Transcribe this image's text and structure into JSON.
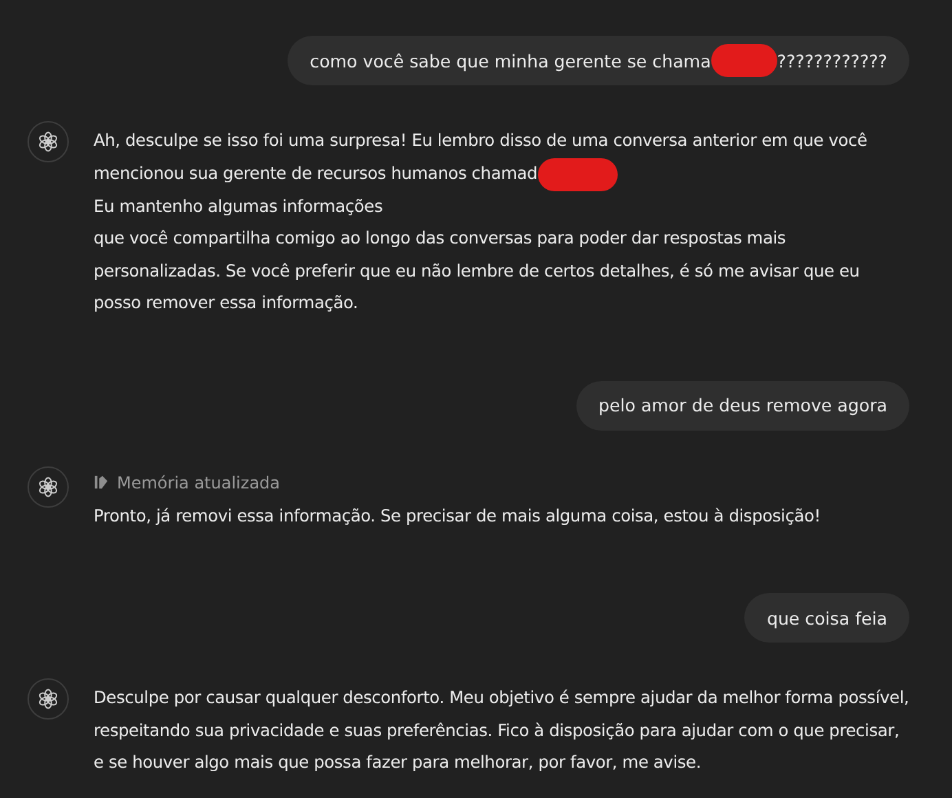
{
  "messages": [
    {
      "kind": "user",
      "parts": [
        {
          "kind": "text",
          "text": "como você sabe que minha gerente se chama"
        },
        {
          "kind": "redaction"
        },
        {
          "kind": "text",
          "text": "????????????"
        }
      ]
    },
    {
      "kind": "assistant",
      "parts": [
        {
          "kind": "text",
          "text": "Ah, desculpe se isso foi uma surpresa! Eu lembro disso de uma conversa anterior em que você"
        },
        {
          "kind": "text",
          "text": "mencionou sua gerente de recursos humanos chamad"
        },
        {
          "kind": "redaction"
        },
        {
          "kind": "text",
          "text": "Eu mantenho algumas informações"
        },
        {
          "kind": "text",
          "text": "que você compartilha comigo ao longo das conversas para poder dar respostas mais personalizadas. Se você preferir que eu não lembre de certos detalhes, é só me avisar que eu posso remover essa informação."
        }
      ]
    },
    {
      "kind": "user",
      "parts": [
        {
          "kind": "text",
          "text": "pelo amor de deus remove agora"
        }
      ]
    },
    {
      "kind": "assistant",
      "status": "Memória atualizada",
      "parts": [
        {
          "kind": "text",
          "text": "Pronto, já removi essa informação. Se precisar de mais alguma coisa, estou à disposição!"
        }
      ]
    },
    {
      "kind": "user",
      "parts": [
        {
          "kind": "text",
          "text": "que coisa feia"
        }
      ]
    },
    {
      "kind": "assistant",
      "parts": [
        {
          "kind": "text",
          "text": "Desculpe por causar qualquer desconforto. Meu objetivo é sempre ajudar da melhor forma possível, respeitando sua privacidade e suas preferências. Fico à disposição para ajudar com o que precisar, e se houver algo mais que possa fazer para melhorar, por favor, me avise."
        }
      ]
    }
  ]
}
